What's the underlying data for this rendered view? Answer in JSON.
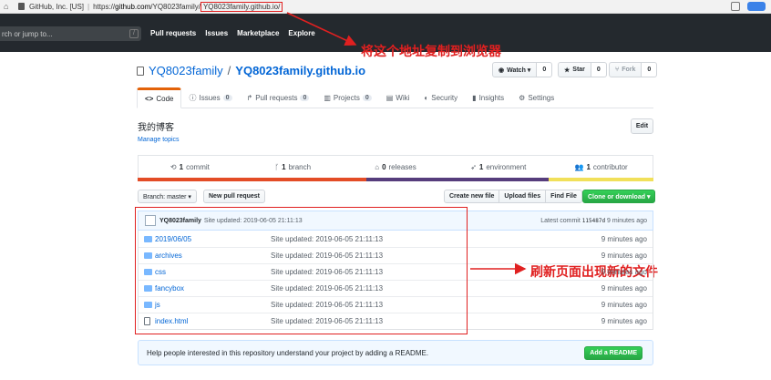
{
  "browser": {
    "site_label": "GitHub, Inc. [US]",
    "url_prefix": "https://",
    "url_host": "github.com",
    "url_path": "/YQ8023family/",
    "url_highlight": "YQ8023family.github.io/"
  },
  "header": {
    "search_placeholder": "rch or jump to...",
    "search_hotkey": "/",
    "nav": [
      "Pull requests",
      "Issues",
      "Marketplace",
      "Explore"
    ]
  },
  "annotations": {
    "copy_address": "将这个地址复制到浏览器",
    "refresh_page": "刷新页面出现新的文件",
    "color": "#e02020"
  },
  "repo": {
    "owner": "YQ8023family",
    "separator": "/",
    "name": "YQ8023family.github.io",
    "watch_label": "Watch ▾",
    "watch_count": "0",
    "star_label": "Star",
    "star_count": "0",
    "fork_label": "Fork",
    "fork_count": "0"
  },
  "tabs": [
    {
      "label": "Code",
      "icon": "<>"
    },
    {
      "label": "Issues",
      "count": "0"
    },
    {
      "label": "Pull requests",
      "count": "0"
    },
    {
      "label": "Projects",
      "count": "0"
    },
    {
      "label": "Wiki"
    },
    {
      "label": "Security"
    },
    {
      "label": "Insights"
    },
    {
      "label": "Settings"
    }
  ],
  "about": {
    "description": "我的博客",
    "manage_topics": "Manage topics",
    "edit_label": "Edit"
  },
  "summary": [
    {
      "count": "1",
      "label": "commit"
    },
    {
      "count": "1",
      "label": "branch"
    },
    {
      "count": "0",
      "label": "releases"
    },
    {
      "count": "1",
      "label": "environment"
    },
    {
      "count": "1",
      "label": "contributor"
    }
  ],
  "lang_colors": [
    "#e34c26",
    "#563d7c",
    "#f1e05a"
  ],
  "toolbar": {
    "branch_label": "Branch: master ▾",
    "new_pr_label": "New pull request",
    "create_file": "Create new file",
    "upload_files": "Upload files",
    "find_file": "Find File",
    "clone_label": "Clone or download ▾"
  },
  "commit": {
    "author": "YQ8023family",
    "message": "Site updated: 2019-06-05 21:11:13",
    "latest_prefix": "Latest commit",
    "sha": "115487d",
    "age": "9 minutes ago"
  },
  "files": [
    {
      "name": "2019/06/05",
      "type": "dir",
      "message": "Site updated: 2019-06-05 21:11:13",
      "age": "9 minutes ago"
    },
    {
      "name": "archives",
      "type": "dir",
      "message": "Site updated: 2019-06-05 21:11:13",
      "age": "9 minutes ago"
    },
    {
      "name": "css",
      "type": "dir",
      "message": "Site updated: 2019-06-05 21:11:13",
      "age": "9 minutes ago"
    },
    {
      "name": "fancybox",
      "type": "dir",
      "message": "Site updated: 2019-06-05 21:11:13",
      "age": "9 minutes ago"
    },
    {
      "name": "js",
      "type": "dir",
      "message": "Site updated: 2019-06-05 21:11:13",
      "age": "9 minutes ago"
    },
    {
      "name": "index.html",
      "type": "file",
      "message": "Site updated: 2019-06-05 21:11:13",
      "age": "9 minutes ago"
    }
  ],
  "readme": {
    "text": "Help people interested in this repository understand your project by adding a README.",
    "button": "Add a README"
  }
}
